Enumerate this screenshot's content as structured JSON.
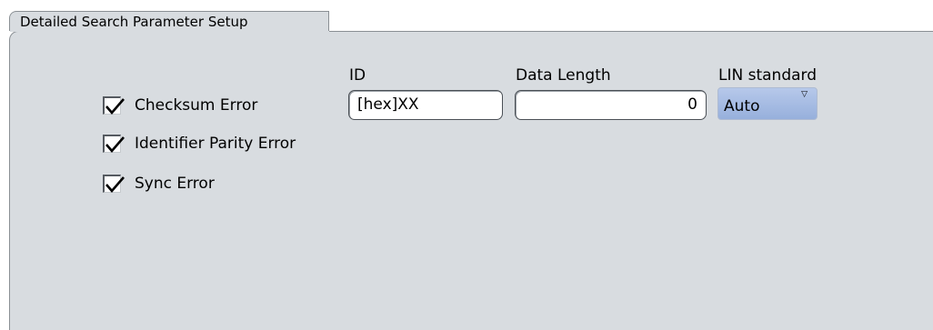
{
  "dialog": {
    "title": "Detailed Search Parameter Setup"
  },
  "checkboxes": [
    {
      "label": "Checksum Error",
      "checked": true
    },
    {
      "label": "Identifier Parity Error",
      "checked": true
    },
    {
      "label": "Sync Error",
      "checked": true
    }
  ],
  "fields": {
    "id": {
      "label": "ID",
      "value": "[hex]XX"
    },
    "data_length": {
      "label": "Data Length",
      "value": "0"
    },
    "lin_standard": {
      "label": "LIN standard",
      "value": "Auto",
      "icon": "dropdown-triangle-icon"
    }
  },
  "colors": {
    "panel_bg": "#d8dce0",
    "combo_accent": "#a7bde4",
    "border": "#8a8f94"
  }
}
